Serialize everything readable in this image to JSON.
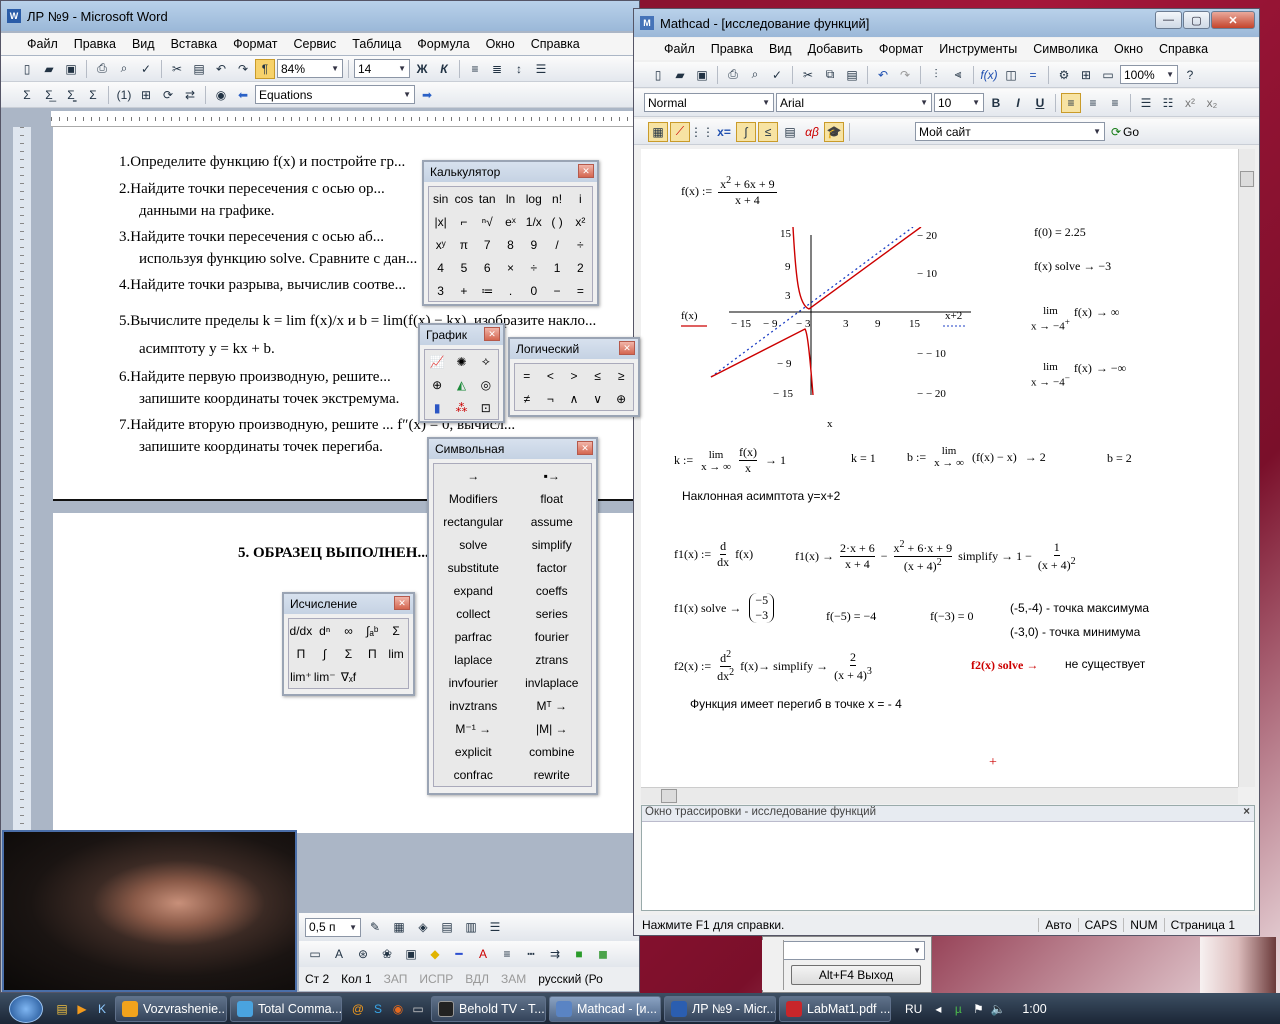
{
  "word": {
    "title": "ЛР №9 - Microsoft Word",
    "menu": [
      "Файл",
      "Правка",
      "Вид",
      "Вставка",
      "Формат",
      "Сервис",
      "Таблица",
      "Формула",
      "Окно",
      "Справка"
    ],
    "zoom": "84%",
    "font_size": "14",
    "equations_label": "Equations",
    "items": [
      {
        "n": "1.",
        "text": "Определите функцию  f(x)  и постройте гр..."
      },
      {
        "n": "2.",
        "text": "Найдите  точки  пересечения  с  осью  ор..."
      },
      {
        "n": "",
        "text": "данными на графике."
      },
      {
        "n": "3.",
        "text": "Найдите  точки  пересечения  с  осью  аб..."
      },
      {
        "n": "",
        "text": "используя функцию solve. Сравните с дан..."
      },
      {
        "n": "4.",
        "text": "Найдите точки разрыва, вычислив соотве..."
      },
      {
        "n": "5.",
        "text": "Вычислите пределы  k = lim f(x)/x  и  b = lim(f(x) − kx), изобразите накло..."
      },
      {
        "n": "",
        "text": "асимптоту  y = kx + b."
      },
      {
        "n": "6.",
        "text": "Найдите  первую  производную,  решите..."
      },
      {
        "n": "",
        "text": "запишите координаты точек экстремума."
      },
      {
        "n": "7.",
        "text": "Найдите  вторую  производную,  решите ... f″(x) = 0,  вычисл..."
      },
      {
        "n": "",
        "text": "запишите координаты точек перегиба."
      }
    ],
    "section_heading": "5. ОБРАЗЕЦ ВЫПОЛНЕН...",
    "status": {
      "page": "Ст 2",
      "col": "Кол 1",
      "zap": "ЗАП",
      "ispr": "ИСПР",
      "vdl": "ВДЛ",
      "zam": "ЗАМ",
      "lang": "русский (Ро"
    },
    "line_width": "0,5 п"
  },
  "mathcad": {
    "title": "Mathcad - [исследование функций]",
    "menu": [
      "Файл",
      "Правка",
      "Вид",
      "Добавить",
      "Формат",
      "Инструменты",
      "Символика",
      "Окно",
      "Справка"
    ],
    "zoom": "100%",
    "style": "Normal",
    "font": "Arial",
    "font_size": "10",
    "site": "Мой сайт",
    "go": "Go",
    "trace_title": "Окно трассировки - исследование функций",
    "status": {
      "help": "Нажмите F1 для справки.",
      "auto": "Авто",
      "caps": "CAPS",
      "num": "NUM",
      "page": "Страница 1"
    },
    "work": {
      "fdef": "f(x) :=",
      "f0": "f(0) = 2.25",
      "solve": "f(x) solve  → −3",
      "lim1": "→ ∞",
      "lim2": "→ −∞",
      "k_res": "→ 1",
      "k_eq": "k = 1",
      "b_res": "→ 2",
      "b_eq": "b = 2",
      "asym_note": "Наклонная асимптота y=x+2",
      "f1_solve": "f1(x) solve →",
      "fm5": "f(−5) = −4",
      "fm3": "f(−3) = 0",
      "max_note": "(-5,-4) - точка максимума",
      "min_note": "(-3,0) - точка минимума",
      "f2_solve": "f2(x) solve →",
      "no_exist": "не существует",
      "inflect_note": "Функция имеет перегиб в точке x = - 4"
    }
  },
  "palettes": {
    "calc_title": "Калькулятор",
    "calc_keys": [
      "sin",
      "cos",
      "tan",
      "ln",
      "log",
      "n!",
      "i",
      "|x|",
      "⌐",
      "ⁿ√",
      "eˣ",
      "1/x",
      "( )",
      "x²",
      "xʸ",
      "π",
      "7",
      "8",
      "9",
      "/",
      "÷",
      "4",
      "5",
      "6",
      "×",
      "÷",
      "1",
      "2",
      "3",
      "+",
      "≔",
      ".",
      "0",
      "−",
      "="
    ],
    "graph_title": "График",
    "logic_title": "Логический",
    "logic_keys": [
      "=",
      "<",
      ">",
      "≤",
      "≥",
      "≠",
      "¬",
      "∧",
      "∨",
      "⊕"
    ],
    "symbolic_title": "Символьная",
    "symbolic_keys": [
      "→",
      "▪→",
      "Modifiers",
      "float",
      "rectangular",
      "assume",
      "solve",
      "simplify",
      "substitute",
      "factor",
      "expand",
      "coeffs",
      "collect",
      "series",
      "parfrac",
      "fourier",
      "laplace",
      "ztrans",
      "invfourier",
      "invlaplace",
      "invztrans",
      "Mᵀ →",
      "M⁻¹ →",
      "|M| →",
      "explicit",
      "combine",
      "confrac",
      "rewrite"
    ],
    "calculus_title": "Исчисление"
  },
  "dialog": {
    "exit_label": "Alt+F4 Выход"
  },
  "taskbar": {
    "items": [
      "Vozvrashenie....",
      "Total Comma...",
      "Behold TV - T...",
      "Mathcad - [и...",
      "ЛР №9 - Micr...",
      "LabMat1.pdf ..."
    ],
    "lang": "RU",
    "clock": "1:00"
  },
  "colors": {
    "accent_red": "#cc0000",
    "asymptote_blue": "#1d3fc4",
    "title_gradient": "#b9d1ea"
  }
}
